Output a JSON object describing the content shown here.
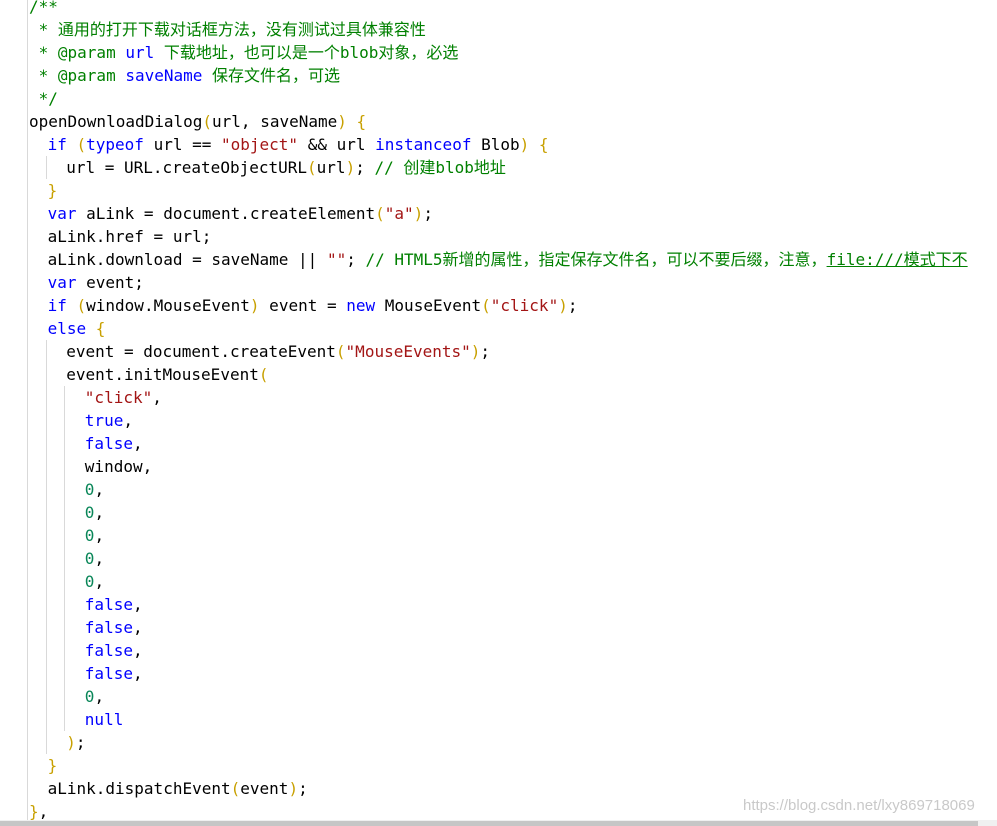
{
  "editor": {
    "lines": [
      {
        "indent": 0,
        "tokens": [
          {
            "t": "/**",
            "c": "com"
          }
        ]
      },
      {
        "indent": 0,
        "tokens": [
          {
            "t": " * 通用的打开下载对话框方法，没有测试过具体兼容性",
            "c": "com"
          }
        ]
      },
      {
        "indent": 0,
        "tokens": [
          {
            "t": " * @param ",
            "c": "com"
          },
          {
            "t": "url",
            "c": "kw"
          },
          {
            "t": " 下载地址，也可以是一个blob对象，必选",
            "c": "com"
          }
        ]
      },
      {
        "indent": 0,
        "tokens": [
          {
            "t": " * @param ",
            "c": "com"
          },
          {
            "t": "saveName",
            "c": "kw"
          },
          {
            "t": " 保存文件名，可选",
            "c": "com"
          }
        ]
      },
      {
        "indent": 0,
        "tokens": [
          {
            "t": " */",
            "c": "com"
          }
        ]
      },
      {
        "indent": 0,
        "tokens": [
          {
            "t": "openDownloadDialog",
            "c": "def"
          },
          {
            "t": "(",
            "c": "br"
          },
          {
            "t": "url, saveName",
            "c": "def"
          },
          {
            "t": ")",
            "c": "br"
          },
          {
            "t": " ",
            "c": "def"
          },
          {
            "t": "{",
            "c": "br"
          }
        ]
      },
      {
        "indent": 1,
        "tokens": [
          {
            "t": "if",
            "c": "kw"
          },
          {
            "t": " ",
            "c": "def"
          },
          {
            "t": "(",
            "c": "br"
          },
          {
            "t": "typeof",
            "c": "kw"
          },
          {
            "t": " url == ",
            "c": "def"
          },
          {
            "t": "\"object\"",
            "c": "str"
          },
          {
            "t": " && url ",
            "c": "def"
          },
          {
            "t": "instanceof",
            "c": "kw"
          },
          {
            "t": " Blob",
            "c": "def"
          },
          {
            "t": ")",
            "c": "br"
          },
          {
            "t": " ",
            "c": "def"
          },
          {
            "t": "{",
            "c": "br"
          }
        ]
      },
      {
        "indent": 2,
        "tokens": [
          {
            "t": "url = URL.createObjectURL",
            "c": "def"
          },
          {
            "t": "(",
            "c": "br"
          },
          {
            "t": "url",
            "c": "def"
          },
          {
            "t": ")",
            "c": "br"
          },
          {
            "t": "; ",
            "c": "def"
          },
          {
            "t": "// 创建blob地址",
            "c": "com"
          }
        ]
      },
      {
        "indent": 1,
        "tokens": [
          {
            "t": "}",
            "c": "br"
          }
        ]
      },
      {
        "indent": 1,
        "tokens": [
          {
            "t": "var",
            "c": "kw"
          },
          {
            "t": " aLink = document.createElement",
            "c": "def"
          },
          {
            "t": "(",
            "c": "br"
          },
          {
            "t": "\"a\"",
            "c": "str"
          },
          {
            "t": ")",
            "c": "br"
          },
          {
            "t": ";",
            "c": "def"
          }
        ]
      },
      {
        "indent": 1,
        "tokens": [
          {
            "t": "aLink.href = url;",
            "c": "def"
          }
        ]
      },
      {
        "indent": 1,
        "tokens": [
          {
            "t": "aLink.download = saveName || ",
            "c": "def"
          },
          {
            "t": "\"\"",
            "c": "str"
          },
          {
            "t": "; ",
            "c": "def"
          },
          {
            "t": "// HTML5新增的属性，指定保存文件名，可以不要后缀，注意，",
            "c": "com"
          },
          {
            "t": "file:///模式下不",
            "c": "link"
          }
        ]
      },
      {
        "indent": 1,
        "tokens": [
          {
            "t": "var",
            "c": "kw"
          },
          {
            "t": " event;",
            "c": "def"
          }
        ]
      },
      {
        "indent": 1,
        "tokens": [
          {
            "t": "if",
            "c": "kw"
          },
          {
            "t": " ",
            "c": "def"
          },
          {
            "t": "(",
            "c": "br"
          },
          {
            "t": "window.MouseEvent",
            "c": "def"
          },
          {
            "t": ")",
            "c": "br"
          },
          {
            "t": " event = ",
            "c": "def"
          },
          {
            "t": "new",
            "c": "kw"
          },
          {
            "t": " MouseEvent",
            "c": "def"
          },
          {
            "t": "(",
            "c": "br"
          },
          {
            "t": "\"click\"",
            "c": "str"
          },
          {
            "t": ")",
            "c": "br"
          },
          {
            "t": ";",
            "c": "def"
          }
        ]
      },
      {
        "indent": 1,
        "tokens": [
          {
            "t": "else",
            "c": "kw"
          },
          {
            "t": " ",
            "c": "def"
          },
          {
            "t": "{",
            "c": "br"
          }
        ]
      },
      {
        "indent": 2,
        "tokens": [
          {
            "t": "event = document.createEvent",
            "c": "def"
          },
          {
            "t": "(",
            "c": "br"
          },
          {
            "t": "\"MouseEvents\"",
            "c": "str"
          },
          {
            "t": ")",
            "c": "br"
          },
          {
            "t": ";",
            "c": "def"
          }
        ]
      },
      {
        "indent": 2,
        "tokens": [
          {
            "t": "event.initMouseEvent",
            "c": "def"
          },
          {
            "t": "(",
            "c": "br"
          }
        ]
      },
      {
        "indent": 3,
        "tokens": [
          {
            "t": "\"click\"",
            "c": "str"
          },
          {
            "t": ",",
            "c": "def"
          }
        ]
      },
      {
        "indent": 3,
        "tokens": [
          {
            "t": "true",
            "c": "kw"
          },
          {
            "t": ",",
            "c": "def"
          }
        ]
      },
      {
        "indent": 3,
        "tokens": [
          {
            "t": "false",
            "c": "kw"
          },
          {
            "t": ",",
            "c": "def"
          }
        ]
      },
      {
        "indent": 3,
        "tokens": [
          {
            "t": "window,",
            "c": "def"
          }
        ]
      },
      {
        "indent": 3,
        "tokens": [
          {
            "t": "0",
            "c": "num"
          },
          {
            "t": ",",
            "c": "def"
          }
        ]
      },
      {
        "indent": 3,
        "tokens": [
          {
            "t": "0",
            "c": "num"
          },
          {
            "t": ",",
            "c": "def"
          }
        ]
      },
      {
        "indent": 3,
        "tokens": [
          {
            "t": "0",
            "c": "num"
          },
          {
            "t": ",",
            "c": "def"
          }
        ]
      },
      {
        "indent": 3,
        "tokens": [
          {
            "t": "0",
            "c": "num"
          },
          {
            "t": ",",
            "c": "def"
          }
        ]
      },
      {
        "indent": 3,
        "tokens": [
          {
            "t": "0",
            "c": "num"
          },
          {
            "t": ",",
            "c": "def"
          }
        ]
      },
      {
        "indent": 3,
        "tokens": [
          {
            "t": "false",
            "c": "kw"
          },
          {
            "t": ",",
            "c": "def"
          }
        ]
      },
      {
        "indent": 3,
        "tokens": [
          {
            "t": "false",
            "c": "kw"
          },
          {
            "t": ",",
            "c": "def"
          }
        ]
      },
      {
        "indent": 3,
        "tokens": [
          {
            "t": "false",
            "c": "kw"
          },
          {
            "t": ",",
            "c": "def"
          }
        ]
      },
      {
        "indent": 3,
        "tokens": [
          {
            "t": "false",
            "c": "kw"
          },
          {
            "t": ",",
            "c": "def"
          }
        ]
      },
      {
        "indent": 3,
        "tokens": [
          {
            "t": "0",
            "c": "num"
          },
          {
            "t": ",",
            "c": "def"
          }
        ]
      },
      {
        "indent": 3,
        "tokens": [
          {
            "t": "null",
            "c": "kw"
          }
        ]
      },
      {
        "indent": 2,
        "tokens": [
          {
            "t": ")",
            "c": "br"
          },
          {
            "t": ";",
            "c": "def"
          }
        ]
      },
      {
        "indent": 1,
        "tokens": [
          {
            "t": "}",
            "c": "br"
          }
        ]
      },
      {
        "indent": 1,
        "tokens": [
          {
            "t": "aLink.dispatchEvent",
            "c": "def"
          },
          {
            "t": "(",
            "c": "br"
          },
          {
            "t": "event",
            "c": "def"
          },
          {
            "t": ")",
            "c": "br"
          },
          {
            "t": ";",
            "c": "def"
          }
        ]
      },
      {
        "indent": 0,
        "tokens": [
          {
            "t": "}",
            "c": "br"
          },
          {
            "t": ",",
            "c": "def"
          }
        ]
      }
    ]
  },
  "watermark": "https://blog.csdn.net/lxy869718069",
  "colors": {
    "comment": "#008000",
    "keyword": "#0000ff",
    "string": "#a31515",
    "number": "#098658",
    "bracket": "#c8a000",
    "default": "#000000"
  }
}
